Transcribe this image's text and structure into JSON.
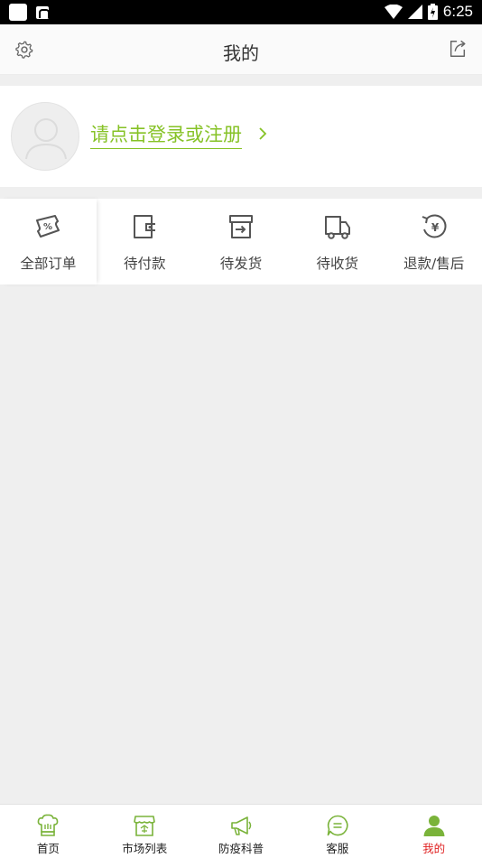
{
  "status_bar": {
    "time": "6:25"
  },
  "header": {
    "title": "我的"
  },
  "login": {
    "prompt": "请点击登录或注册"
  },
  "orders": {
    "items": [
      {
        "label": "全部订单",
        "icon": "coupon-icon"
      },
      {
        "label": "待付款",
        "icon": "wallet-icon"
      },
      {
        "label": "待发货",
        "icon": "box-icon"
      },
      {
        "label": "待收货",
        "icon": "truck-icon"
      },
      {
        "label": "退款/售后",
        "icon": "refund-icon"
      }
    ]
  },
  "bottom_nav": {
    "items": [
      {
        "label": "首页",
        "icon": "home-icon",
        "active": false
      },
      {
        "label": "市场列表",
        "icon": "market-icon",
        "active": false
      },
      {
        "label": "防疫科普",
        "icon": "megaphone-icon",
        "active": false
      },
      {
        "label": "客服",
        "icon": "chat-icon",
        "active": false
      },
      {
        "label": "我的",
        "icon": "user-icon",
        "active": true
      }
    ]
  },
  "colors": {
    "accent_green": "#86c226",
    "active_red": "#e02424",
    "icon_gray": "#555555"
  }
}
